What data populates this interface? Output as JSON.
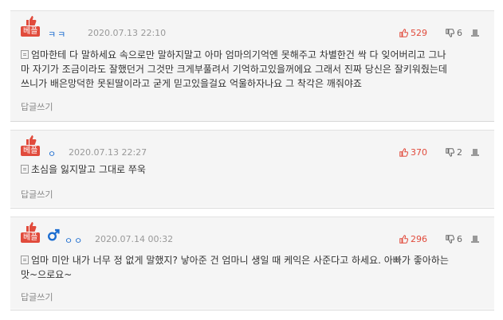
{
  "comments": [
    {
      "badge": "베플",
      "nickname": "ㅋㅋ",
      "gender": "",
      "date": "2020.07.13 22:10",
      "likes": "529",
      "dislikes": "6",
      "lines": [
        "엄마한테 다 말하세요 속으로만 말하지말고 아마 엄마의기억엔 못해주고 차별한건 싹 다 잊어버리고 그나",
        "마 자기가 조금이라도 잘했던거 그것만 크게부풀려서 기억하고있을꺼에요 그래서 진짜 당신은 잘키워줬는데",
        "쓰니가 배은망덕한 못된딸이라고 굳게 믿고있을걸요 억울하자나요 그 착각은 깨줘야죠"
      ],
      "reply_label": "답글쓰기"
    },
    {
      "badge": "베플",
      "nickname": "ㅇ",
      "gender": "",
      "date": "2020.07.13 22:27",
      "likes": "370",
      "dislikes": "2",
      "lines": [
        "초심을 잃지말고 그대로 쭈욱"
      ],
      "reply_label": "답글쓰기"
    },
    {
      "badge": "베플",
      "nickname": "ㅇㅇ",
      "gender": "male",
      "date": "2020.07.14 00:32",
      "likes": "296",
      "dislikes": "6",
      "lines": [
        "엄마 미안 내가 너무 정 없게 말했지? 낳아준 건 엄마니 생일 때 케익은 사준다고 하세요. 아빠가 좋아하는",
        "맛~으로요~"
      ],
      "reply_label": "답글쓰기"
    }
  ],
  "colors": {
    "accent": "#e14b3c",
    "nickname": "#1c6dd0",
    "gender_male": "#1c6dd0"
  }
}
